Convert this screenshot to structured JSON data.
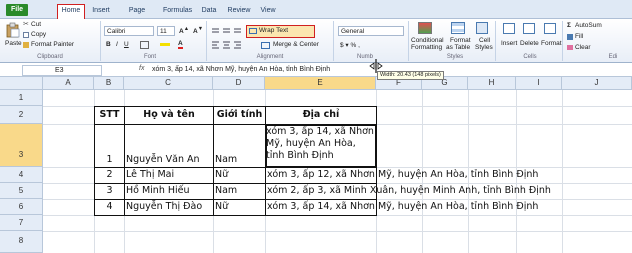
{
  "ribbon_tabs": [
    "File",
    "Home",
    "Insert",
    "Page Layout",
    "Formulas",
    "Data",
    "Review",
    "View"
  ],
  "clipboard": {
    "paste": "Paste",
    "cut": "Cut",
    "copy": "Copy",
    "format_painter": "Format Painter",
    "group": "Clipboard"
  },
  "font": {
    "name": "Calibri",
    "size": "11",
    "group": "Font"
  },
  "alignment": {
    "wrap_text": "Wrap Text",
    "merge_center": "Merge & Center",
    "group": "Alignment"
  },
  "number": {
    "format": "General",
    "group": "Numb"
  },
  "styles": {
    "conditional": "Conditional",
    "conditional2": "Formatting",
    "format_as": "Format",
    "format_as2": "as Table",
    "cell_styles": "Cell",
    "cell_styles2": "Styles",
    "group": "Styles"
  },
  "cells": {
    "insert": "Insert",
    "delete": "Delete",
    "format": "Format",
    "group": "Cells"
  },
  "editing": {
    "autosum": "AutoSum",
    "fill": "Fill",
    "clear": "Clear",
    "group": "Edi"
  },
  "formula_bar": {
    "name_box": "E3",
    "fx": "fx",
    "formula": "xóm 3, ấp 14, xã Nhơn Mỹ, huyện An Hòa, tỉnh Bình Định"
  },
  "tooltip": "Width: 20.43 (148 pixels)",
  "columns": [
    "A",
    "B",
    "C",
    "D",
    "E",
    "F",
    "G",
    "H",
    "I",
    "J"
  ],
  "rows": [
    "1",
    "2",
    "3",
    "4",
    "5",
    "6",
    "7",
    "8"
  ],
  "table": {
    "headers": {
      "stt": "STT",
      "name": "Họ và tên",
      "gender": "Giới tính",
      "address": "Địa chỉ"
    },
    "r3": {
      "stt": "1",
      "name": "Nguyễn Văn An",
      "gender": "Nam",
      "address": "xóm 3, ấp 14, xã Nhơn Mỹ, huyện An Hòa, tỉnh Bình Định"
    },
    "r4": {
      "stt": "2",
      "name": "Lê Thị Mai",
      "gender": "Nữ",
      "address": "xóm 3, ấp 12, xã Nhơn Mỹ, huyện An Hòa, tỉnh Bình Định"
    },
    "r5": {
      "stt": "3",
      "name": "Hồ Minh Hiếu",
      "gender": "Nam",
      "address": "xóm 2, ấp 3, xã Minh Xuân, huyện Minh Anh, tỉnh Bình Định"
    },
    "r6": {
      "stt": "4",
      "name": "Nguyễn Thị Đào",
      "gender": "Nữ",
      "address": "xóm 3, ấp 14, xã Nhơn Mỹ, huyện An Hòa, tỉnh Bình Định"
    }
  },
  "colors": {
    "selection": "#f9d98a",
    "accent_red": "#d02020",
    "file_tab": "#2a8a2a"
  }
}
